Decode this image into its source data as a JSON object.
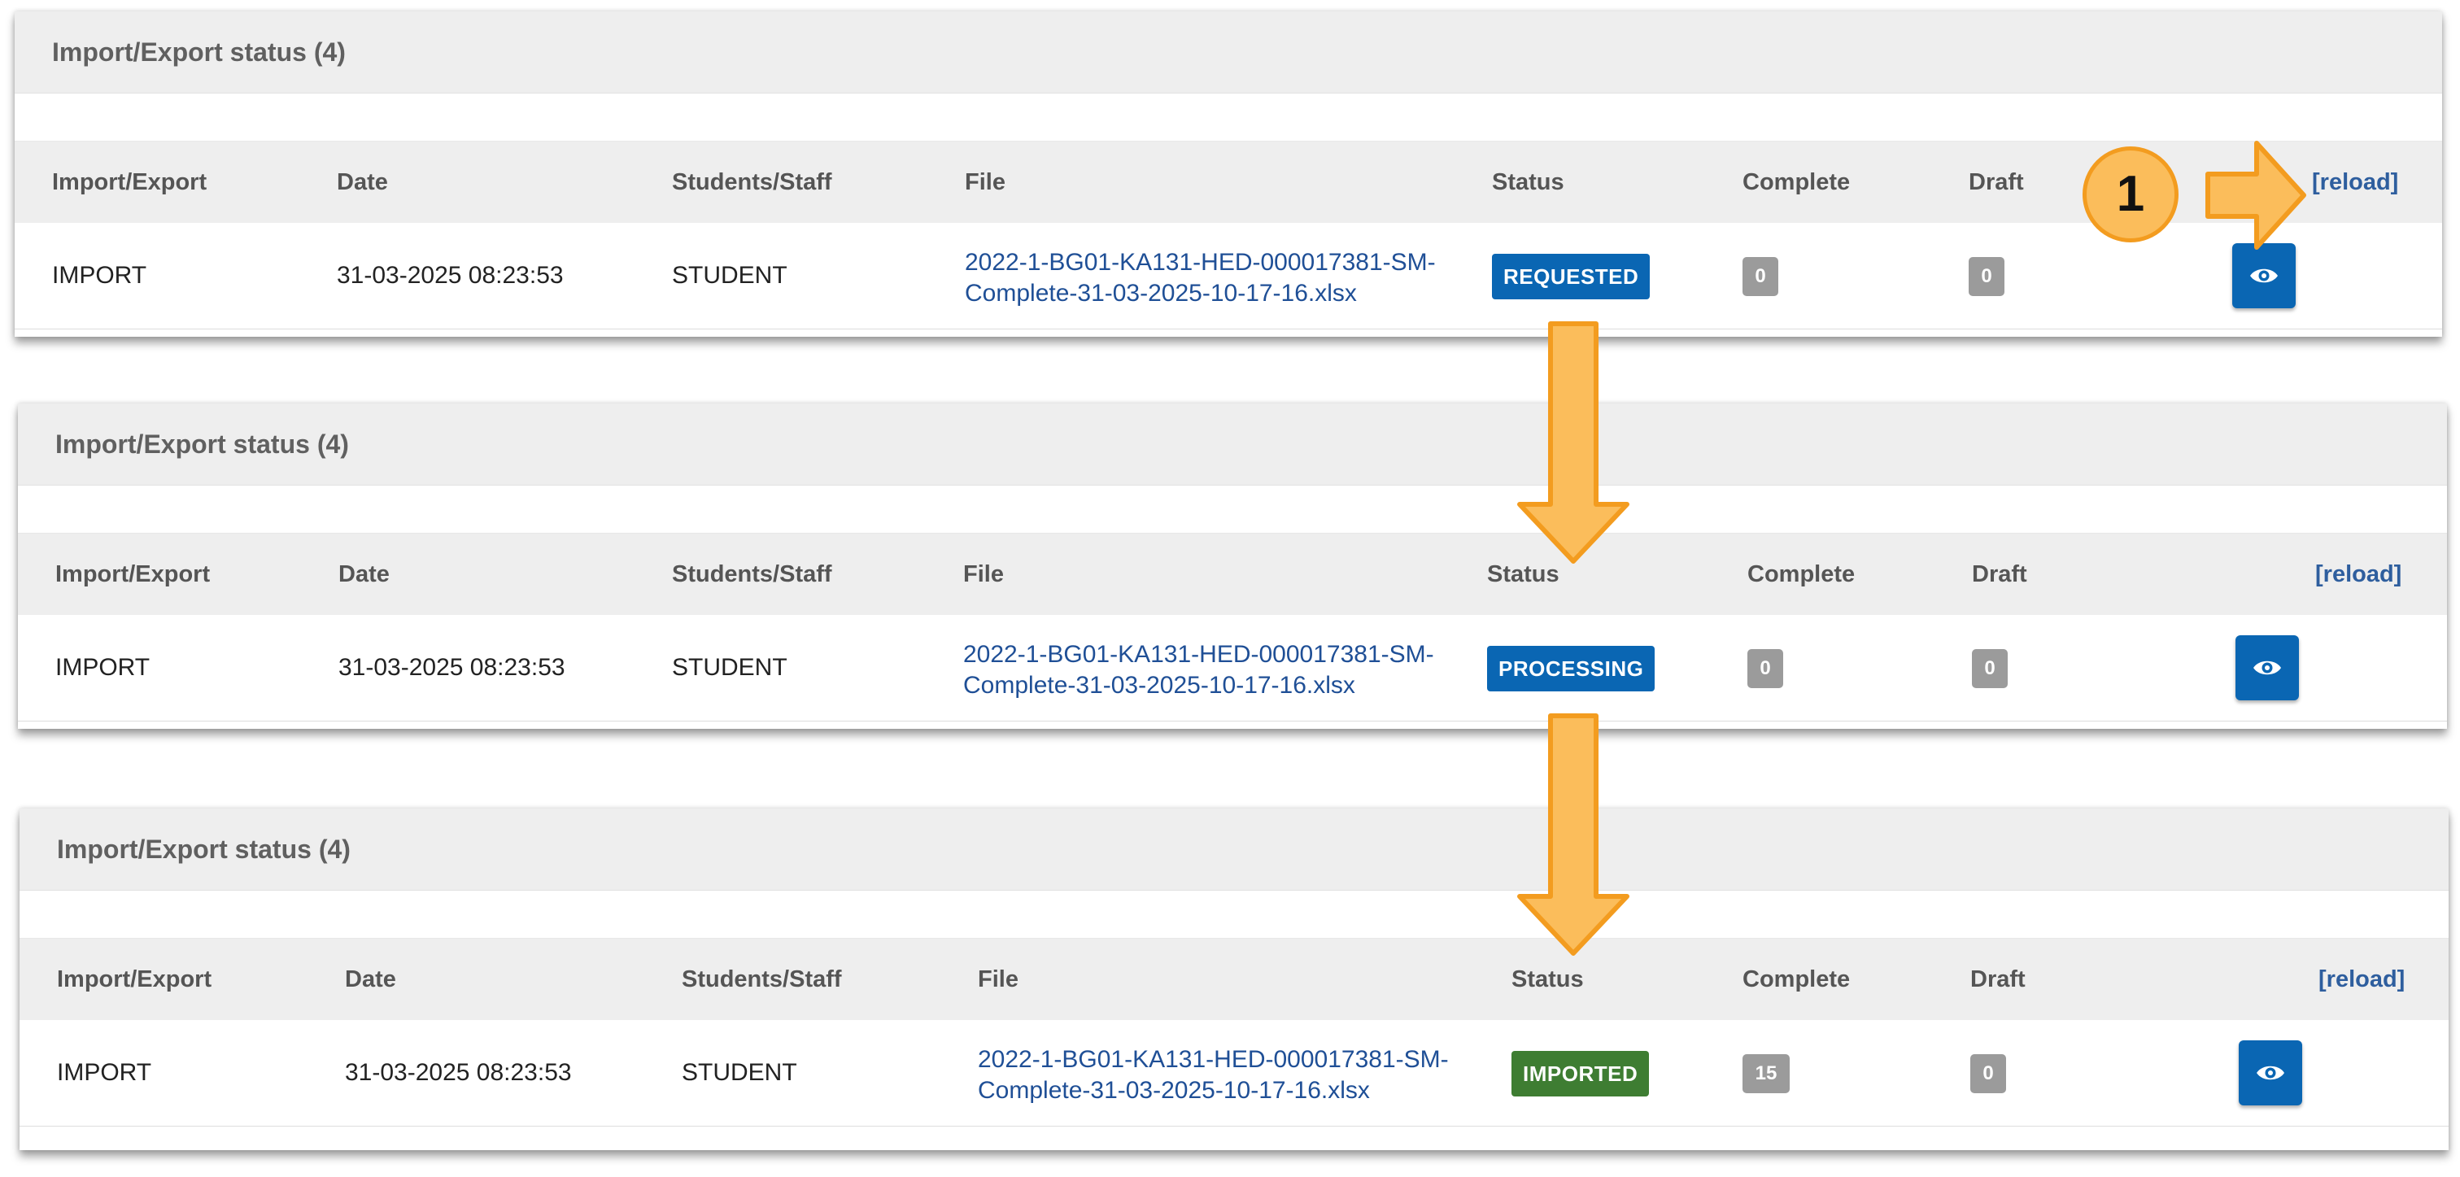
{
  "panels": [
    {
      "title": "Import/Export status (4)",
      "headers": [
        "Import/Export",
        "Date",
        "Students/Staff",
        "File",
        "Status",
        "Complete",
        "Draft"
      ],
      "reload": "[reload]",
      "row": {
        "type": "IMPORT",
        "date": "31-03-2025 08:23:53",
        "target": "STUDENT",
        "file_line1": "2022-1-BG01-KA131-HED-000017381-SM-",
        "file_line2": "Complete-31-03-2025-10-17-16.xlsx",
        "status": "REQUESTED",
        "status_color": "#0a66b3",
        "complete": "0",
        "draft": "0",
        "action_icon": "eye-icon"
      }
    },
    {
      "title": "Import/Export status (4)",
      "headers": [
        "Import/Export",
        "Date",
        "Students/Staff",
        "File",
        "Status",
        "Complete",
        "Draft"
      ],
      "reload": "[reload]",
      "row": {
        "type": "IMPORT",
        "date": "31-03-2025 08:23:53",
        "target": "STUDENT",
        "file_line1": "2022-1-BG01-KA131-HED-000017381-SM-",
        "file_line2": "Complete-31-03-2025-10-17-16.xlsx",
        "status": "PROCESSING",
        "status_color": "#0a66b3",
        "complete": "0",
        "draft": "0",
        "action_icon": "eye-icon"
      }
    },
    {
      "title": "Import/Export status (4)",
      "headers": [
        "Import/Export",
        "Date",
        "Students/Staff",
        "File",
        "Status",
        "Complete",
        "Draft"
      ],
      "reload": "[reload]",
      "row": {
        "type": "IMPORT",
        "date": "31-03-2025 08:23:53",
        "target": "STUDENT",
        "file_line1": "2022-1-BG01-KA131-HED-000017381-SM-",
        "file_line2": "Complete-31-03-2025-10-17-16.xlsx",
        "status": "IMPORTED",
        "status_color": "#3e7d32",
        "complete": "15",
        "draft": "0",
        "action_icon": "eye-icon"
      }
    }
  ],
  "annotation": {
    "step_number": "1",
    "step_icon": "arrow-right-icon",
    "flow_icon": "arrow-down-icon",
    "accent_fill": "#fbbd5b",
    "accent_stroke": "#f39c1f"
  }
}
